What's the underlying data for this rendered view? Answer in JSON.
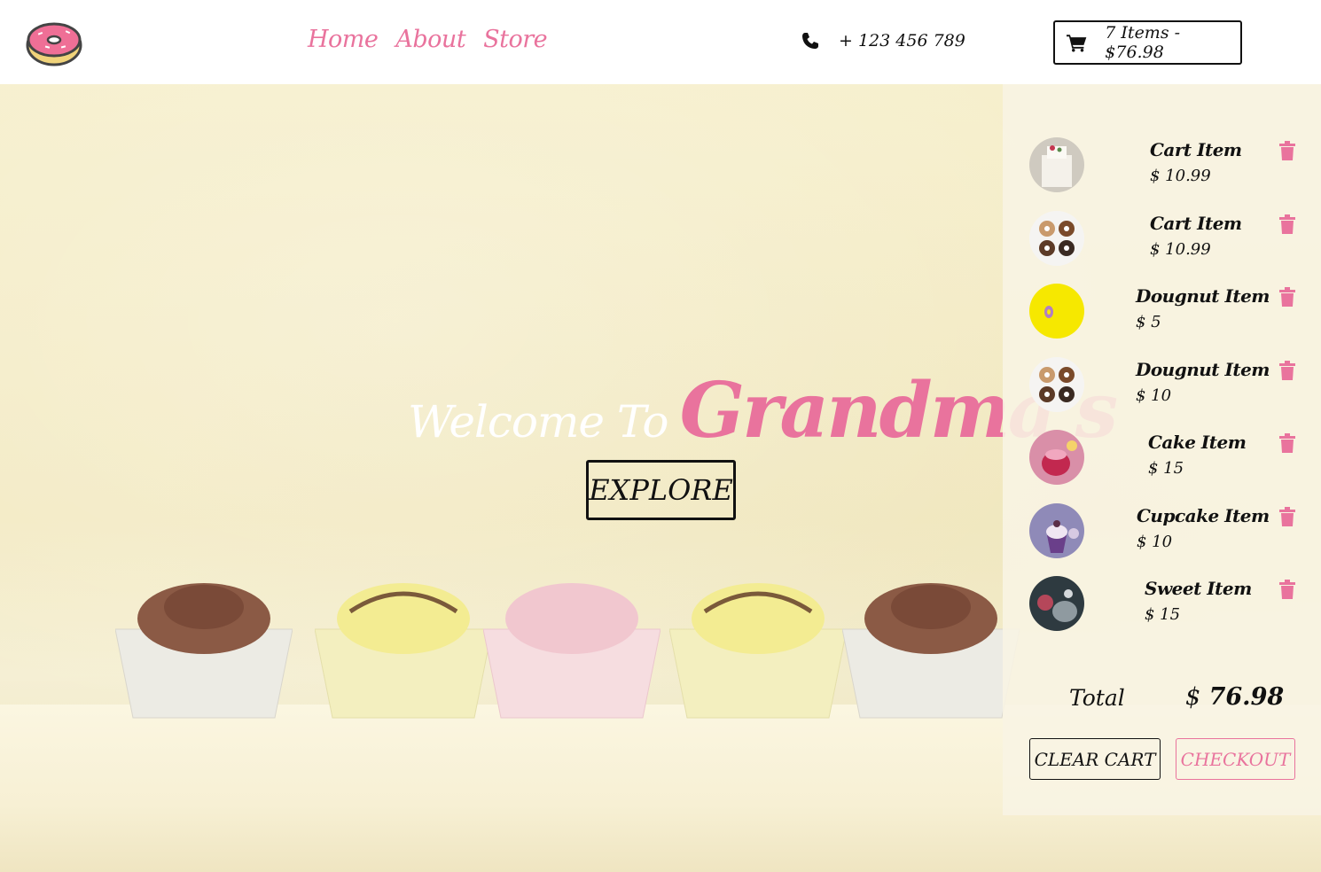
{
  "colors": {
    "accent": "#e9739d",
    "text": "#111111",
    "nav_bg": "#ffffff",
    "hero_bg": "#f6edc7"
  },
  "navbar": {
    "logo_icon": "donut-icon",
    "links": [
      {
        "label": "Home"
      },
      {
        "label": "About"
      },
      {
        "label": "Store"
      }
    ],
    "phone_icon": "phone-icon",
    "phone": "+ 123 456 789",
    "cart_icon": "shopping-cart-icon",
    "cart_summary": "7 Items - $76.98"
  },
  "hero": {
    "welcome": "Welcome To",
    "brand": "Grandma's",
    "explore_label": "EXPLORE"
  },
  "cart": {
    "items": [
      {
        "name": "Cart Item",
        "price": "$ 10.99",
        "thumb": "cake-white"
      },
      {
        "name": "Cart Item",
        "price": "$ 10.99",
        "thumb": "donuts"
      },
      {
        "name": "Dougnut Item",
        "price": "$ 5",
        "thumb": "donut-yellow"
      },
      {
        "name": "Dougnut Item",
        "price": "$ 10",
        "thumb": "donuts"
      },
      {
        "name": "Cake Item",
        "price": "$ 15",
        "thumb": "cake-pink"
      },
      {
        "name": "Cupcake Item",
        "price": "$ 10",
        "thumb": "cupcakes"
      },
      {
        "name": "Sweet Item",
        "price": "$ 15",
        "thumb": "sweets-dark"
      }
    ],
    "trash_icon": "trash-icon",
    "total_label": "Total",
    "total_currency": "$",
    "total_value": "76.98",
    "clear_label": "CLEAR CART",
    "checkout_label": "CHECKOUT"
  }
}
